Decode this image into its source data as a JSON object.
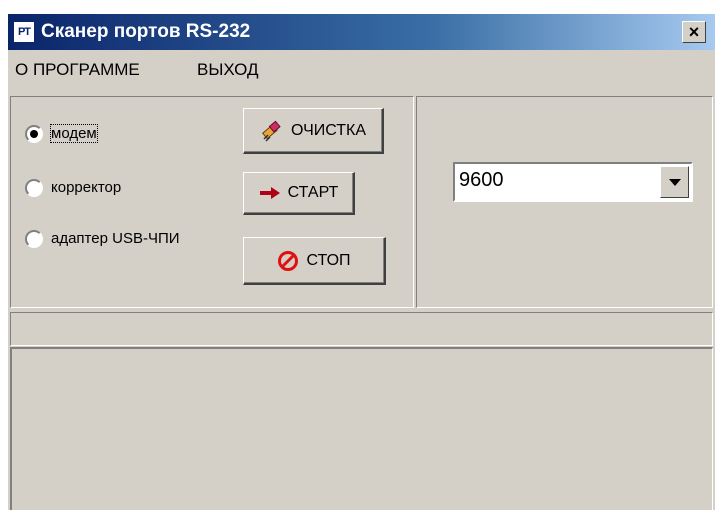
{
  "window": {
    "title": "Сканер портов RS-232",
    "icon_name": "app-logo-icon",
    "icon_text": "РТ",
    "close_label": "×"
  },
  "menu": {
    "items": [
      {
        "label": "О ПРОГРАММЕ"
      },
      {
        "label": "ВЫХОД"
      }
    ]
  },
  "device_options": {
    "selected": "модем",
    "items": [
      {
        "label": "модем",
        "checked": true
      },
      {
        "label": "корректор",
        "checked": false
      },
      {
        "label": "адаптер USB-ЧПИ",
        "checked": false
      }
    ]
  },
  "buttons": {
    "clear": {
      "label": "ОЧИСТКА",
      "icon": "eraser-icon"
    },
    "start": {
      "label": "СТАРТ",
      "icon": "arrow-right-icon"
    },
    "stop": {
      "label": "СТОП",
      "icon": "no-entry-icon"
    }
  },
  "baud_rate": {
    "value": "9600",
    "icon": "chevron-down-icon"
  },
  "status_bar": {
    "text": ""
  },
  "output_area": {
    "text": ""
  },
  "colors": {
    "title_bar_start": "#0a246a",
    "title_bar_end": "#a6caf0",
    "window_face": "#d4d0c8",
    "start_arrow": "#b00018",
    "stop_icon": "#e01010"
  }
}
